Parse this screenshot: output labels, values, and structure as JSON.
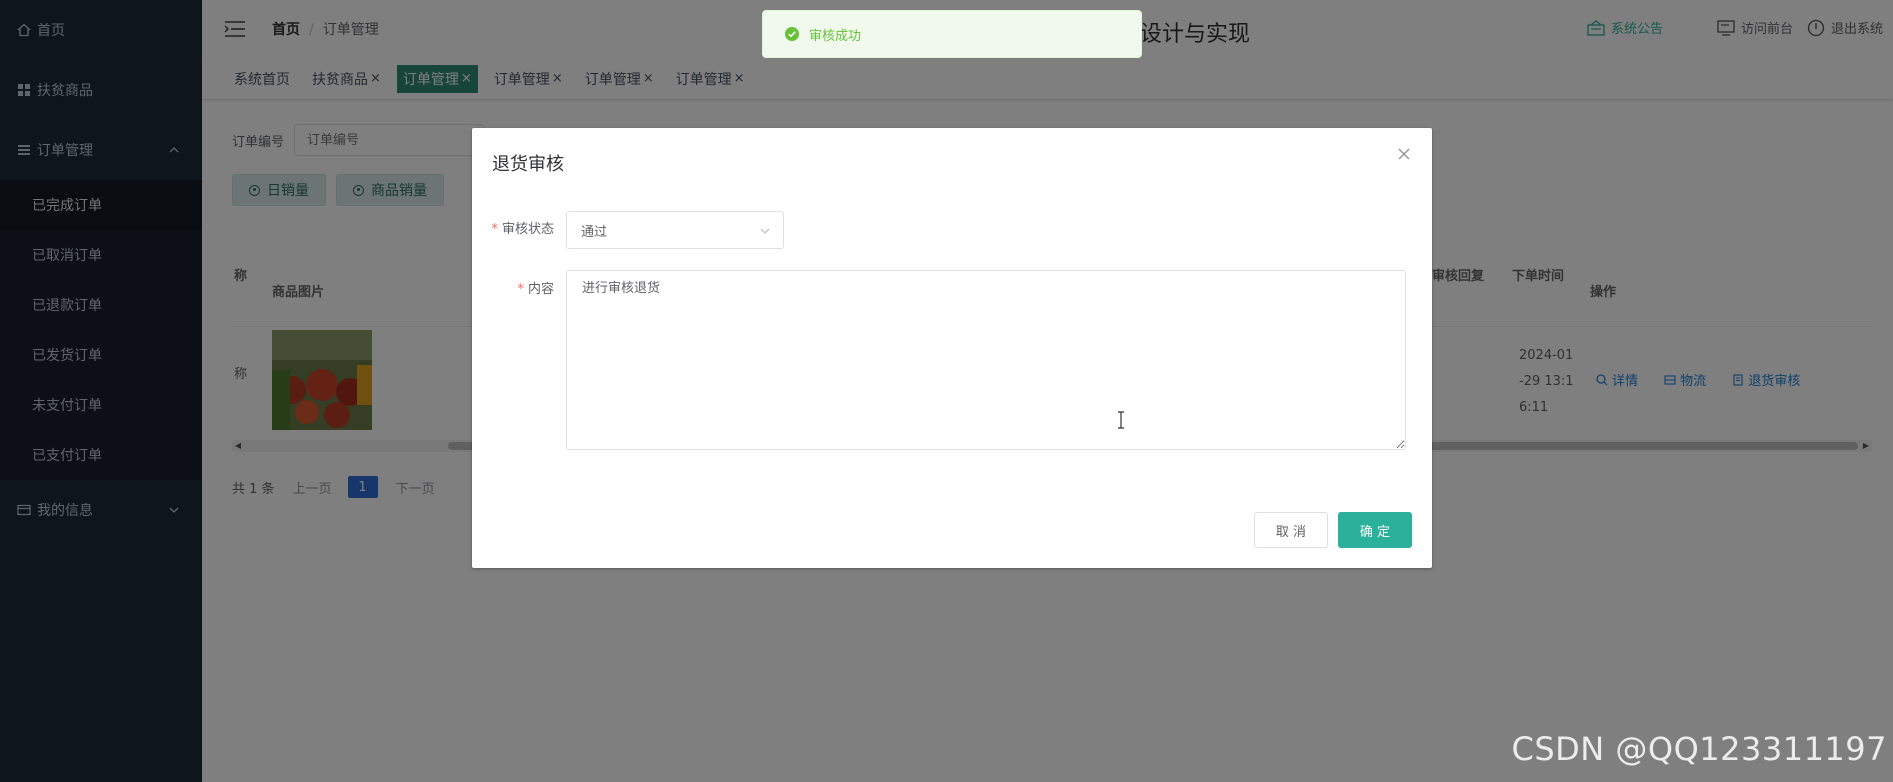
{
  "sidebar": {
    "items": [
      {
        "label": "首页",
        "icon": "home-icon"
      },
      {
        "label": "扶贫商品",
        "icon": "grid-icon"
      },
      {
        "label": "订单管理",
        "icon": "list-icon"
      },
      {
        "label": "我的信息",
        "icon": "card-icon"
      }
    ],
    "submenu": [
      "已完成订单",
      "已取消订单",
      "已退款订单",
      "已发货订单",
      "未支付订单",
      "已支付订单"
    ],
    "active_sub": "已完成订单"
  },
  "topbar": {
    "breadcrumb_home": "首页",
    "breadcrumb_sep": "/",
    "breadcrumb_current": "订单管理",
    "system_title": "设计与实现",
    "notice": "系统公告",
    "visit_front": "访问前台",
    "logout": "退出系统"
  },
  "tabs": [
    {
      "label": "系统首页",
      "closable": false,
      "active": false
    },
    {
      "label": "扶贫商品",
      "closable": true,
      "active": false
    },
    {
      "label": "订单管理",
      "closable": true,
      "active": true
    },
    {
      "label": "订单管理",
      "closable": true,
      "active": false
    },
    {
      "label": "订单管理",
      "closable": true,
      "active": false
    },
    {
      "label": "订单管理",
      "closable": true,
      "active": false
    }
  ],
  "search": {
    "label": "订单编号",
    "placeholder": "订单编号"
  },
  "buttons": {
    "daily_sales": "日销量",
    "product_sales": "商品销量"
  },
  "table": {
    "headers": {
      "name_partial": "称",
      "product_image": "商品图片",
      "review_reply": "审核回复",
      "order_time": "下单时间",
      "actions": "操作"
    },
    "row": {
      "name_partial": "称",
      "order_time_lines": [
        "2024-01",
        "-29 13:1",
        "6:11"
      ],
      "actions": {
        "detail": "详情",
        "logistics": "物流",
        "return_review": "退货审核"
      }
    }
  },
  "pager": {
    "total": "共 1 条",
    "prev": "上一页",
    "page": "1",
    "next": "下一页"
  },
  "dialog": {
    "title": "退货审核",
    "status_label": "审核状态",
    "status_value": "通过",
    "content_label": "内容",
    "content_value": "进行审核退货",
    "cancel": "取 消",
    "ok": "确 定"
  },
  "toast": {
    "message": "审核成功"
  },
  "watermark": "CSDN @QQ123311197",
  "colors": {
    "sidebar_bg": "#1f2a38",
    "accent": "#2bb09c",
    "tab_active": "#2e8b6f",
    "toast_text": "#67c23a",
    "link": "#1e7ed8"
  }
}
